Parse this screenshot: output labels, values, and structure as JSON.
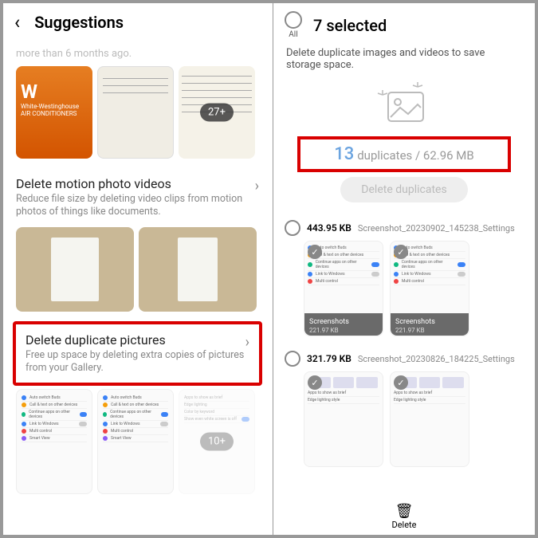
{
  "left": {
    "title": "Suggestions",
    "faded_hint": "more than 6 months ago.",
    "photo_badge": "27+",
    "brand_line1": "White-Westinghouse",
    "brand_line2": "AIR CONDITIONERS",
    "section_motion": {
      "title": "Delete motion photo videos",
      "desc": "Reduce file size by deleting video clips from motion photos of things like documents."
    },
    "section_dup": {
      "title": "Delete duplicate pictures",
      "desc": "Free up space by deleting extra copies of pictures from your Gallery."
    },
    "settings_rows": [
      "Auto switch Buds",
      "Call & text on other devices",
      "Continue apps on other devices",
      "Link to Windows",
      "Multi control",
      "Smart View"
    ],
    "stack_badge": "10+"
  },
  "right": {
    "all_label": "All",
    "selected_title": "7 selected",
    "desc": "Delete duplicate images and videos to save storage space.",
    "dup_count": "13",
    "dup_line": "duplicates / 62.96 MB",
    "delete_dup_btn": "Delete duplicates",
    "groups": [
      {
        "size": "443.95 KB",
        "name": "Screenshot_20230902_145238_Settings",
        "thumb_label": "Screenshots",
        "thumb_size": "221.97 KB"
      },
      {
        "size": "321.79 KB",
        "name": "Screenshot_20230826_184225_Settings",
        "thumb_label": "",
        "thumb_size": ""
      }
    ],
    "thumb_rows_a": [
      "Auto switch Buds",
      "Call & text on other devices",
      "Continue apps on other devices",
      "Link to Windows",
      "Multi control"
    ],
    "thumb_rows_b": [
      "Apps to show as brief",
      "Edge lighting style"
    ],
    "delete_label": "Delete"
  }
}
